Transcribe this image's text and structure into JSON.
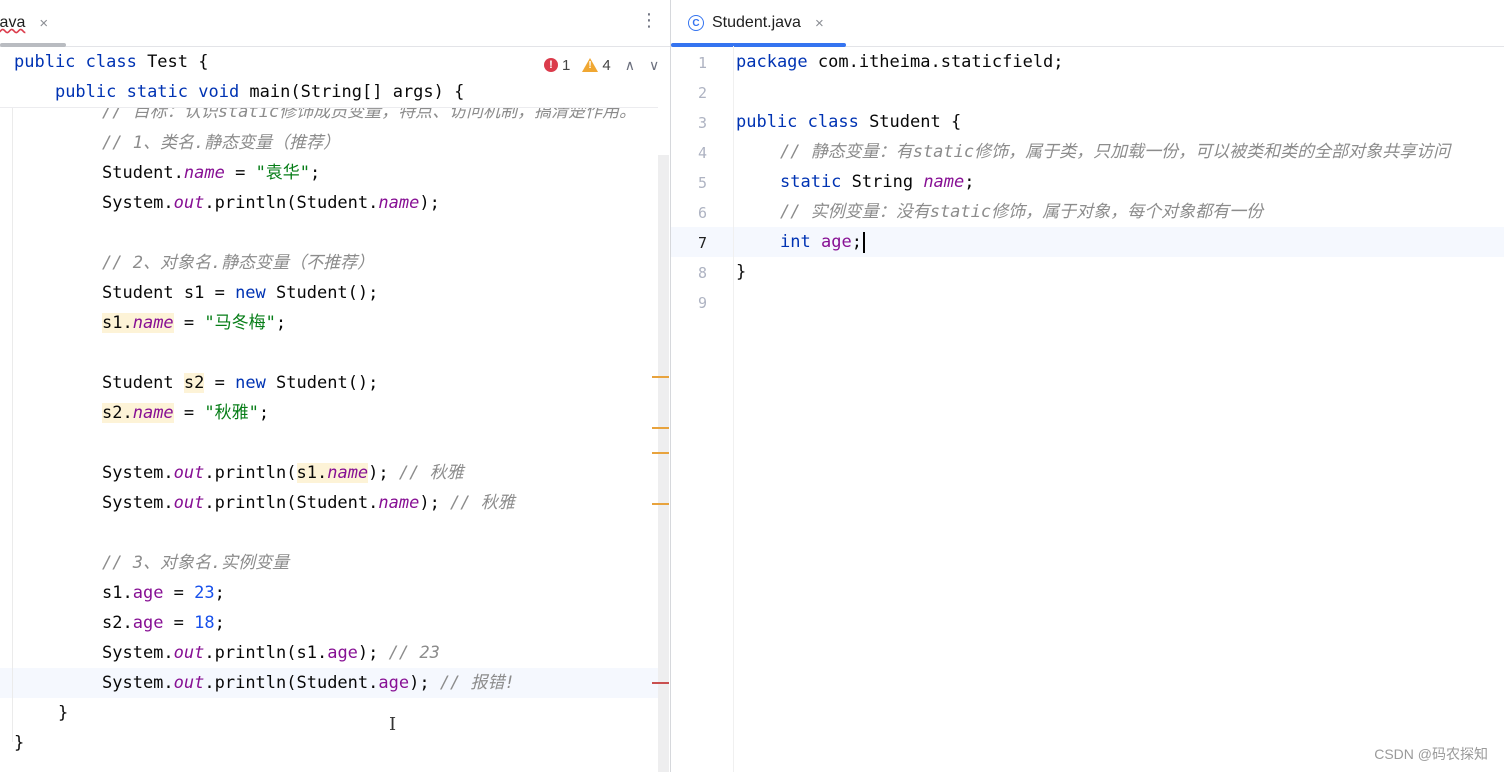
{
  "left_editor": {
    "tab": {
      "label": "java",
      "close": "×"
    },
    "more_icon": "⋮",
    "inspections": {
      "errors": "1",
      "warnings": "4",
      "up": "∧",
      "down": "∨"
    },
    "sticky": {
      "line1": "public class Test {",
      "line2": "    public static void main(String[] args) {"
    },
    "text_cursor": "I"
  },
  "right_editor": {
    "tab": {
      "label": "Student.java",
      "close": "×",
      "icon": "C"
    },
    "line_numbers": [
      "1",
      "2",
      "3",
      "4",
      "5",
      "6",
      "7",
      "8",
      "9"
    ]
  },
  "watermark": "CSDN @码农探知",
  "colors": {
    "accent": "#3574f0",
    "keyword": "#0033b3",
    "field": "#871094",
    "string": "#067d17",
    "comment": "#8c8c8c",
    "number": "#1750eb",
    "error": "#db3b4b",
    "warning": "#f0a732"
  }
}
